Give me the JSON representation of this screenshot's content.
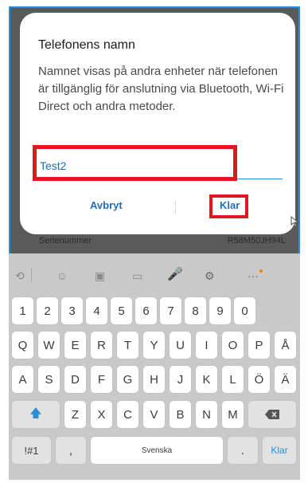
{
  "dialog": {
    "title": "Telefonens namn",
    "body": "Namnet visas på andra enheter när telefonen är tillgänglig för anslutning via Bluetooth, Wi-Fi Direct och andra metoder.",
    "input_value": "Test2",
    "cancel_label": "Avbryt",
    "ok_label": "Klar"
  },
  "background": {
    "serial_label": "Serienummer",
    "serial_value": "R58M50JH94L"
  },
  "keyboard": {
    "toolbar": [
      "translate-icon",
      "emoji-icon",
      "sticker-icon",
      "gif-icon",
      "mic-icon",
      "settings-icon",
      "more-icon"
    ],
    "row_numbers": [
      "1",
      "2",
      "3",
      "4",
      "5",
      "6",
      "7",
      "8",
      "9",
      "0"
    ],
    "row_q": [
      "Q",
      "W",
      "E",
      "R",
      "T",
      "Y",
      "U",
      "I",
      "O",
      "P",
      "Å"
    ],
    "row_a": [
      "A",
      "S",
      "D",
      "F",
      "G",
      "H",
      "J",
      "K",
      "L",
      "Ö",
      "Ä"
    ],
    "row_z": [
      "Z",
      "X",
      "C",
      "V",
      "B",
      "N",
      "M"
    ],
    "symbols_label": "!#1",
    "comma_label": ",",
    "space_label": "Svenska",
    "period_label": ".",
    "enter_label": "Klar"
  },
  "colors": {
    "accent": "#2a90d4",
    "highlight": "#e0181e"
  }
}
